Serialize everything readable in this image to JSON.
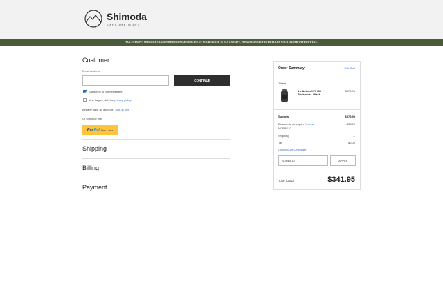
{
  "brand": {
    "name": "Shimoda",
    "tagline": "EXPLORE MORE"
  },
  "banner": {
    "text_before": "TAX EXEMPT? SHIMODA CANNOT BE PROCESSED ONLINE. IF YOUR ORDER IS TAX EXEMPT, PLEASE ",
    "link": "CONTACT US",
    "text_after": " TO PLACE YOUR ORDER WITHOUT TAX."
  },
  "customer": {
    "title": "Customer",
    "email_label": "Email Address",
    "email_value": "",
    "continue_label": "CONTINUE",
    "newsletter_label": "Subscribe to our newsletter.",
    "newsletter_checked": true,
    "privacy_prefix": "Yes, I agree with the ",
    "privacy_link": "privacy policy",
    "privacy_suffix": ".",
    "privacy_checked": false,
    "have_account": "Already have an account? ",
    "sign_in": "Sign in now",
    "or_continue": "Or continue with",
    "paypal_a": "Pay",
    "paypal_b": "Pal",
    "paypal_later": "Pay Later"
  },
  "sections": [
    "Shipping",
    "Billing",
    "Payment"
  ],
  "summary": {
    "title": "Order Summary",
    "edit_cart": "Edit Cart",
    "items_count": "1 Item",
    "product": {
      "name": "1 x Action X70 HD Backpack - Black",
      "price": "$379.95"
    },
    "subtotal_label": "Subtotal",
    "subtotal_value": "$379.95",
    "discount_label": "Descuento de cupón ",
    "discount_remove": "Remove",
    "discount_code": "NORBE10",
    "discount_value": "-$38.00",
    "shipping_label": "Shipping",
    "shipping_value": "--",
    "tax_label": "Tax",
    "tax_value": "$0.00",
    "coupon_link": "Coupon/Gift Certificate",
    "coupon_value": "NORBE10",
    "apply_label": "APPLY",
    "total_label": "Total (USD)",
    "total_value": "$341.95"
  },
  "colors": {
    "banner": "#4b5a3a",
    "link": "#3a6fc4",
    "button": "#2e2e2e",
    "paypal": "#ffc439"
  }
}
